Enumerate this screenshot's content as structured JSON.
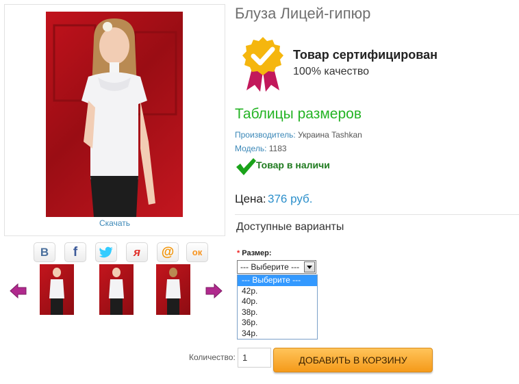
{
  "product": {
    "title": "Блуза Лицей-гипюр",
    "download_label": "Скачать",
    "certified_title": "Товар сертифицирован",
    "certified_sub": "100% качество",
    "size_table_link": "Таблицы размеров",
    "manufacturer_key": "Производитель:",
    "manufacturer_value": "Украина Tashkan",
    "model_key": "Модель:",
    "model_value": "1183",
    "stock_text": "Товар в наличи",
    "price_label": "Цена:",
    "price_value": "376 руб."
  },
  "options": {
    "heading": "Доступные варианты",
    "required_mark": "*",
    "size_label": "Размер:",
    "selected": "--- Выберите ---",
    "size_options": [
      "--- Выберите ---",
      "42р.",
      "40р.",
      "38р.",
      "36р.",
      "34р."
    ]
  },
  "cart": {
    "quantity_label": "Количество:",
    "quantity_value": "1",
    "add_button": "ДОБАВИТЬ В КОРЗИНУ"
  },
  "share": {
    "icons": [
      "vk-icon",
      "facebook-icon",
      "twitter-icon",
      "yaru-icon",
      "mailru-icon",
      "odnoklassniki-icon"
    ],
    "glyphs": {
      "vk": "B",
      "facebook": "f",
      "yaru": "я",
      "mailru": "@",
      "ok": "ок"
    }
  },
  "colors": {
    "accent_green": "#23b323",
    "price_blue": "#2b8fcb",
    "button_orange": "#f59a1a",
    "arrow_magenta": "#b0298d",
    "background_red": "#c1121c"
  }
}
